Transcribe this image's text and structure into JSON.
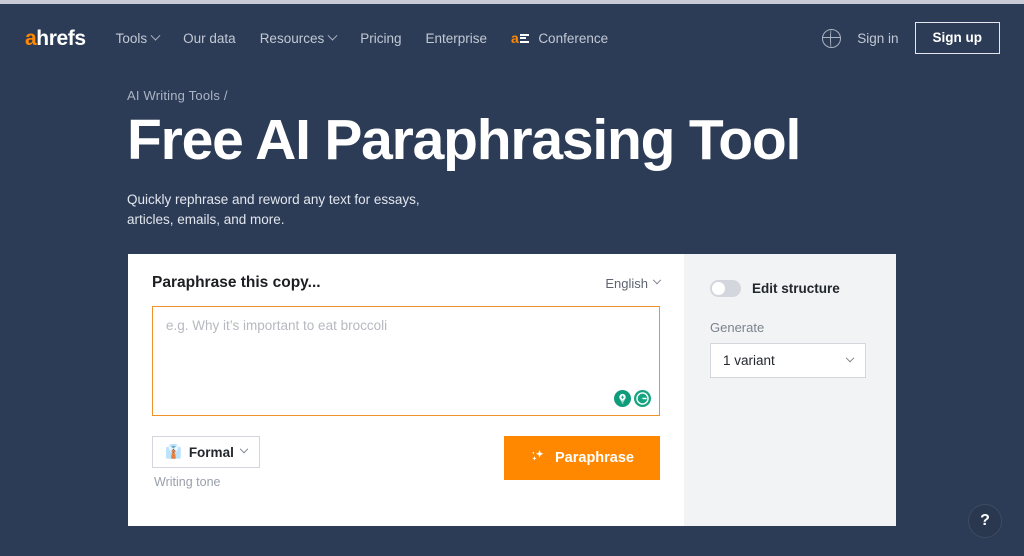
{
  "theme": {
    "bg": "#2d3c56",
    "accent": "#ff8800",
    "card_bg": "#ffffff",
    "panel_bg": "#f1f3f5",
    "editor_border": "#f0922b"
  },
  "nav": {
    "logo_a": "a",
    "logo_rest": "hrefs",
    "links": [
      {
        "label": "Tools",
        "caret": true
      },
      {
        "label": "Our data",
        "caret": false
      },
      {
        "label": "Resources",
        "caret": true
      },
      {
        "label": "Pricing",
        "caret": false
      },
      {
        "label": "Enterprise",
        "caret": false
      }
    ],
    "conference": {
      "mark_a": "a",
      "label": "Conference"
    },
    "globe_icon": "globe-icon",
    "sign_in": "Sign in",
    "sign_up": "Sign up"
  },
  "hero": {
    "breadcrumb": "AI Writing Tools /",
    "title": "Free AI Paraphrasing Tool",
    "subtitle_line1": "Quickly rephrase and reword any text for essays,",
    "subtitle_line2": "articles, emails, and more."
  },
  "tool": {
    "card_title": "Paraphrase this copy...",
    "language": "English",
    "editor_placeholder": "e.g. Why it’s important to eat broccoli",
    "grammarly_bulb_icon": "lightbulb-plus-icon",
    "grammarly_g_icon": "grammarly-g-icon",
    "tone_emoji": "👔",
    "tone_value": "Formal",
    "tone_caption": "Writing tone",
    "paraphrase_icon": "sparkles-icon",
    "paraphrase_label": "Paraphrase"
  },
  "panel": {
    "edit_structure_label": "Edit structure",
    "edit_structure_on": false,
    "generate_label": "Generate",
    "variant_value": "1 variant"
  },
  "help": {
    "label": "?"
  }
}
